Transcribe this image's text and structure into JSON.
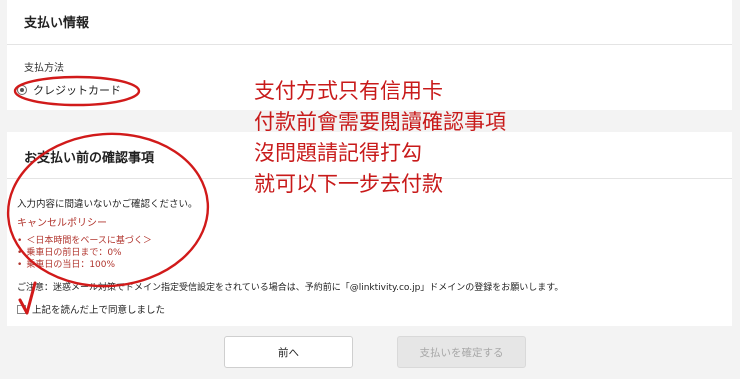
{
  "payment_info": {
    "title": "支払い情報",
    "method_label": "支払方法",
    "method_option": "クレジットカード"
  },
  "confirmation": {
    "title": "お支払い前の確認事項",
    "intro": "入力内容に間違いないかご確認ください。",
    "policy_link": "キャンセルポリシー",
    "policy_items": [
      "＜日本時間をベースに基づく＞",
      "乗車日の前日まで：0%",
      "乗車日の当日：100%"
    ],
    "notice": "ご注意：迷惑メール対策でドメイン指定受信設定をされている場合は、予約前に「@linktivity.co.jp」ドメインの登録をお願いします。",
    "agree_label": "上記を読んだ上で同意しました"
  },
  "buttons": {
    "back": "前へ",
    "confirm": "支払いを確定する"
  },
  "annotation": {
    "lines": [
      "支付方式只有信用卡",
      "付款前會需要閱讀確認事項",
      "沒問題請記得打勾",
      "就可以下一步去付款"
    ],
    "color": "#c81a1a"
  }
}
